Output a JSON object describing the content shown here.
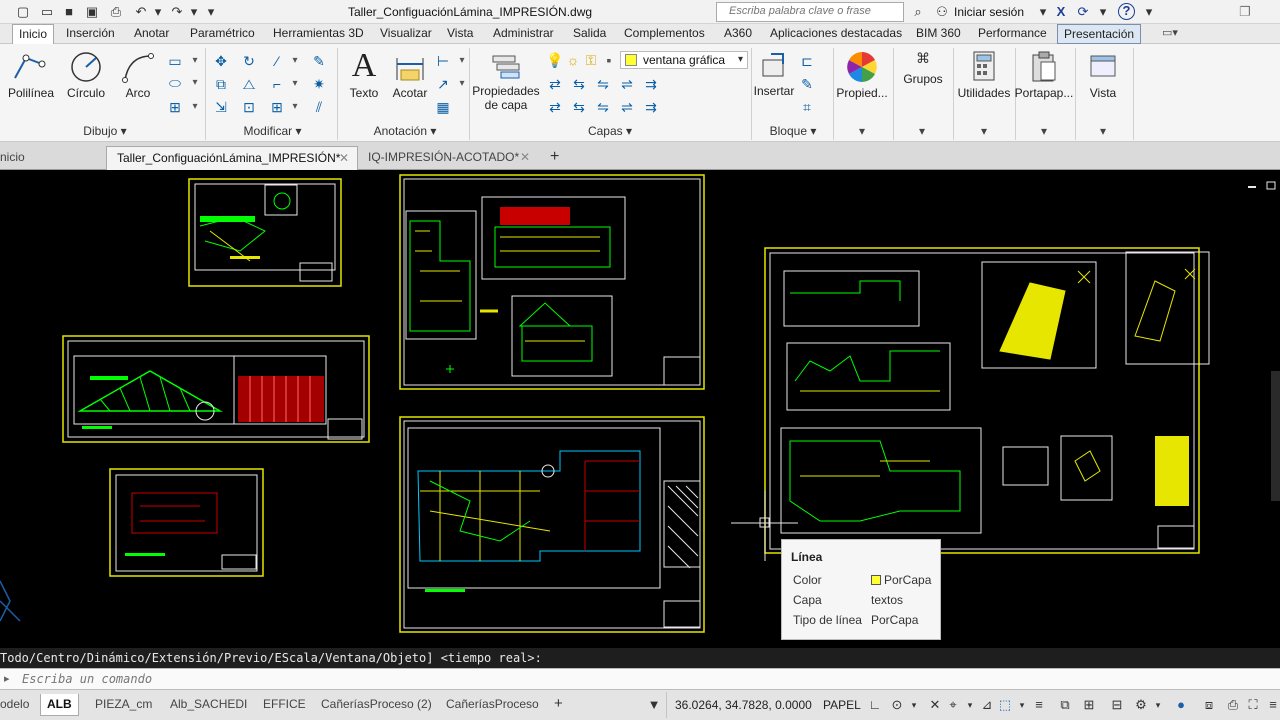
{
  "titlebar": {
    "document_title": "Taller_ConfiguaciónLámina_IMPRESIÓN.dwg",
    "search_placeholder": "Escriba palabra clave o frase",
    "sign_in_label": "Iniciar sesión",
    "help_label": "?"
  },
  "menubar": {
    "tabs": [
      {
        "label": "Inicio"
      },
      {
        "label": "Inserción"
      },
      {
        "label": "Anotar"
      },
      {
        "label": "Paramétrico"
      },
      {
        "label": "Herramientas 3D"
      },
      {
        "label": "Visualizar"
      },
      {
        "label": "Vista"
      },
      {
        "label": "Administrar"
      },
      {
        "label": "Salida"
      },
      {
        "label": "Complementos"
      },
      {
        "label": "A360"
      },
      {
        "label": "Aplicaciones destacadas"
      },
      {
        "label": "BIM 360"
      },
      {
        "label": "Performance"
      },
      {
        "label": "Presentación"
      }
    ]
  },
  "ribbon": {
    "dibujo": {
      "title": "Dibujo",
      "polilinea": "Polilínea",
      "circulo": "Círculo",
      "arco": "Arco"
    },
    "modificar": {
      "title": "Modificar"
    },
    "anotacion": {
      "title": "Anotación",
      "texto": "Texto",
      "acotar": "Acotar"
    },
    "capas": {
      "title": "Capas",
      "propiedades_line1": "Propiedades",
      "propiedades_line2": "de capa",
      "current_layer": "ventana gráfica"
    },
    "bloque": {
      "title": "Bloque",
      "insertar": "Insertar"
    },
    "propiedades": "Propied...",
    "grupos": "Grupos",
    "utilidades": "Utilidades",
    "portapapeles": "Portapap...",
    "vista": "Vista"
  },
  "file_tabs": [
    {
      "label": "nicio"
    },
    {
      "label": "Taller_ConfiguaciónLámina_IMPRESIÓN*"
    },
    {
      "label": "IQ-IMPRESIÓN-ACOTADO*"
    }
  ],
  "tooltip": {
    "title": "Línea",
    "rows": [
      {
        "key": "Color",
        "value": "PorCapa"
      },
      {
        "key": "Capa",
        "value": "textos"
      },
      {
        "key": "Tipo de línea",
        "value": "PorCapa"
      }
    ],
    "color_swatch": "#ffff33"
  },
  "command": {
    "history_line": "Todo/Centro/Dinámico/Extensión/Previo/EScala/Ventana/Objeto] <tiempo real>:",
    "input_placeholder": "Escriba un comando"
  },
  "status": {
    "layout_tabs": [
      {
        "label": "odelo"
      },
      {
        "label": "ALB"
      },
      {
        "label": "PIEZA_cm"
      },
      {
        "label": "Alb_SACHEDI"
      },
      {
        "label": "EFFICE"
      },
      {
        "label": "CañeríasProceso (2)"
      },
      {
        "label": "CañeríasProceso"
      }
    ],
    "coordinates": "36.0264, 34.7828, 0.0000",
    "space": "PAPEL"
  },
  "colors": {
    "accent": "#0b5fa5",
    "drawing_yellow": "#e6e600",
    "drawing_green": "#00ff00",
    "drawing_red": "#c80000",
    "drawing_cyan": "#00c8ff",
    "viewport_bg": "#000000"
  }
}
